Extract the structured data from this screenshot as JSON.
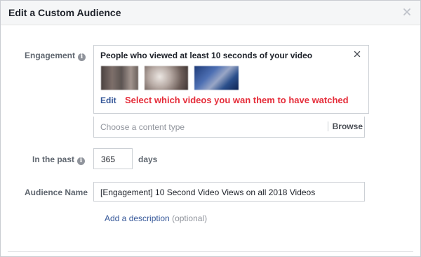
{
  "dialog": {
    "title": "Edit a Custom Audience"
  },
  "engagement": {
    "label": "Engagement",
    "rule_title": "People who viewed at least 10 seconds of your video",
    "edit_label": "Edit",
    "annotation": "Select which videos you wan them to have watched",
    "thumbnail_count": 3
  },
  "content_type": {
    "placeholder": "Choose a content type",
    "browse_label": "Browse"
  },
  "past": {
    "label": "In the past",
    "value": "365",
    "unit": "days"
  },
  "audience_name": {
    "label": "Audience Name",
    "value": "[Engagement] 10 Second Video Views on all 2018 Videos"
  },
  "description": {
    "link_label": "Add a description",
    "optional_label": "(optional)"
  },
  "icons": {
    "info": "info-icon",
    "close": "close-icon"
  },
  "colors": {
    "link": "#365899",
    "annotation": "#e52d3a",
    "header_bg": "#f5f6f7"
  }
}
